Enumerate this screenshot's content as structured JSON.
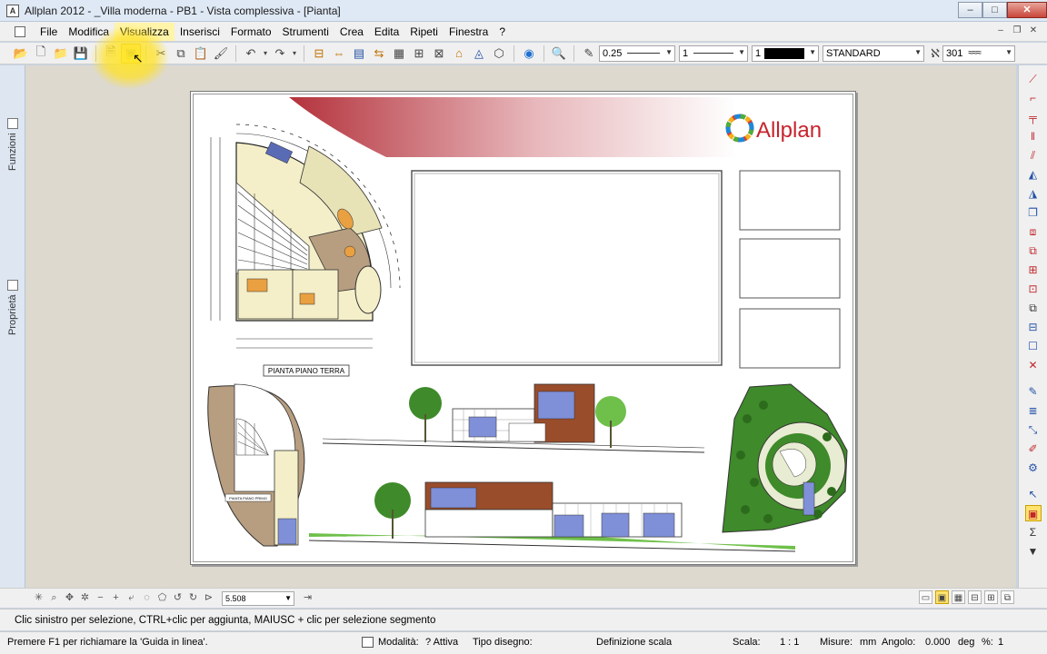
{
  "window": {
    "title": "Allplan 2012 - _Villa moderna - PB1 - Vista complessiva - [Pianta]",
    "controls": {
      "minimize": "–",
      "maximize": "□",
      "close": "✕"
    }
  },
  "menu": {
    "items": [
      "File",
      "Modifica",
      "Visualizza",
      "Inserisci",
      "Formato",
      "Strumenti",
      "Crea",
      "Edita",
      "Ripeti",
      "Finestra",
      "?"
    ],
    "active": "Visualizza"
  },
  "toolbar": {
    "pen_thickness": "0.25",
    "line_type": "1",
    "color_index": "1",
    "layer": "STANDARD",
    "hatch_number": "301"
  },
  "side_tabs": {
    "functions": "Funzioni",
    "properties": "Proprietà"
  },
  "sheet": {
    "logo": "Allplan",
    "floor_plan_label": "PIANTA PIANO TERRA",
    "small_plan_label": "PIANTA PIANO PRIMO",
    "colors": {
      "banner": "#b4323c",
      "wall_fill": "#f4efc9",
      "terrace": "#e8e2b7",
      "stair_wall": "#b79e80",
      "roof_brown": "#9a4d2b",
      "window_blue": "#7f8fd8",
      "tree_green": "#3f8a2a",
      "lawn_green": "#6fc04a"
    }
  },
  "viewbar": {
    "zoom_value": "5.508"
  },
  "hint": {
    "text": "Clic sinistro per selezione, CTRL+clic per aggiunta, MAIUSC + clic per selezione segmento"
  },
  "status": {
    "help": "Premere F1 per richiamare la 'Guida in linea'.",
    "mode_label": "Modalità:",
    "mode_value": "? Attiva",
    "drawing_type_label": "Tipo disegno:",
    "scale_definition": "Definizione scala",
    "scale_label": "Scala:",
    "scale_value": "1 : 1",
    "units_label": "Misure:",
    "units_value": "mm",
    "angle_label": "Angolo:",
    "angle_value": "0.000",
    "angle_unit": "deg",
    "percent_label": "%:",
    "percent_value": "1"
  }
}
